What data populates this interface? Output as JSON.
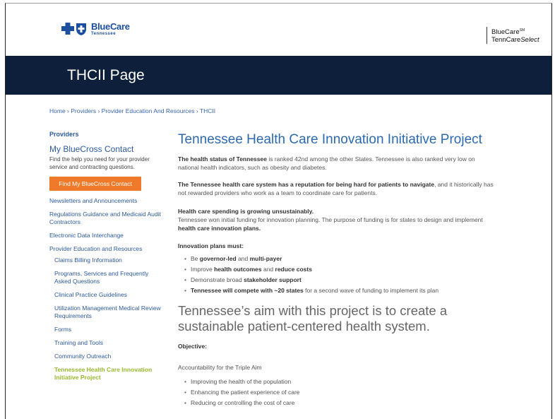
{
  "header": {
    "logo_brand": "BlueCare",
    "logo_sub": "Tennessee",
    "right_line1": "BlueCare",
    "right_line1_mark": "SM",
    "right_line2": "TennCare",
    "right_line2_italic": "Select"
  },
  "title_bar": {
    "title": "THCII Page"
  },
  "breadcrumb": "Home › Providers › Provider Education And Resources › THCII",
  "sidebar": {
    "heading": "Providers",
    "contact_title": "My BlueCross Contact",
    "contact_desc": "Find the help you need for your provider service and contracting questions.",
    "cta_label": "Find My BlueCross Contact",
    "links": [
      "Newsletters and Announcements",
      "Regulations Guidance and Medicaid Audit Contractors",
      "Electronic Data Interchange",
      "Provider Education and Resources"
    ],
    "sub_links": [
      "Claims Billing Information",
      "Programs, Services and Frequently Asked Questions",
      "Clinical Practice Guidelines",
      "Utilization Management Medical Review Requirements",
      "Forms",
      "Training and Tools",
      "Community Outreach",
      "Tennessee Health Care Innovation Initiative Project"
    ]
  },
  "main": {
    "title": "Tennessee Health Care Innovation Initiative Project",
    "p1_bold": "The health status of Tennessee",
    "p1_rest": " is ranked 42nd among the other States. Tennessee is also ranked very low on national health indicators, such as obesity and diabetes.",
    "p2_bold": "The Tennessee health care system has a reputation for being hard for patients to navigate",
    "p2_rest": ", and it historically has not rewarded providers who work as a team to coordinate care for patients.",
    "p3_heading": "Health care spending is growing unsustainably.",
    "p3_text": "Tennessee won initial funding for innovation planning. The purpose of funding is for states to design and implement ",
    "p3_bold": "health care innovation plans.",
    "plans_heading": "Innovation plans must:",
    "plans": {
      "b1_pre": "Be ",
      "b1_bold1": "governor-led",
      "b1_mid": " and ",
      "b1_bold2": "multi-payer",
      "b2_pre": "Improve ",
      "b2_bold1": "health outcomes",
      "b2_mid": " and ",
      "b2_bold2": "reduce costs",
      "b3_pre": "Demonstrate broad ",
      "b3_bold": "stakeholder support",
      "b4_bold": "Tennessee will compete with ~20 states",
      "b4_rest": " for a second wave of funding to implement its plan"
    },
    "aim_heading": "Tennessee’s aim with this project is to create a sustainable patient-centered health system.",
    "objective": "Objective:",
    "accountability": "Accountability for the Triple Aim",
    "aims": [
      "Improving the health of the population",
      "Enhancing the patient experience of care",
      "Reducing or controlling the cost of care"
    ]
  }
}
